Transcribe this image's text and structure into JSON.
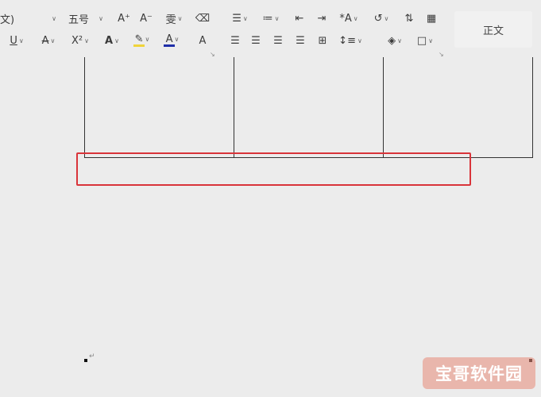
{
  "toolbar": {
    "font_name_partial": "文)",
    "font_size": "五号",
    "grow_font": "A⁺",
    "shrink_font": "A⁻",
    "phonetic": "雯",
    "superscript": "X²",
    "text_effect": "A",
    "font_color_glyph": "A",
    "highlight_glyph": "✎",
    "char_shading_glyph": "A",
    "underline_glyph": "U",
    "strike_glyph": "A",
    "case_glyph": "A",
    "styles_preview": "正文"
  },
  "watermark": {
    "text": "宝哥软件园"
  },
  "colors": {
    "highlight_yellow": "#f0d43a",
    "font_color_blue": "#1e2ea8",
    "annotation_red": "#d9343a"
  }
}
